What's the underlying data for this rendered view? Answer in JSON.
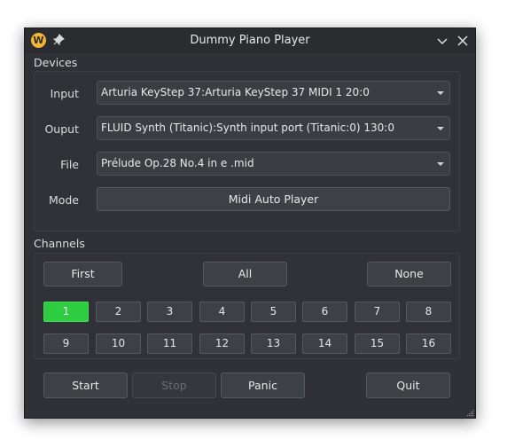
{
  "window": {
    "title": "Dummy Piano Player"
  },
  "icons": {
    "app": "app-logo-icon",
    "pin": "pin-icon",
    "collapse": "chevron-down-icon",
    "close": "close-icon"
  },
  "devices": {
    "group_label": "Devices",
    "input": {
      "label": "Input",
      "value": "Arturia KeyStep 37:Arturia KeyStep 37 MIDI 1 20:0"
    },
    "output": {
      "label": "Ouput",
      "value": "FLUID Synth (Titanic):Synth input port (Titanic:0) 130:0"
    },
    "file": {
      "label": "File",
      "value": "Prélude Op.28 No.4 in e .mid"
    },
    "mode": {
      "label": "Mode",
      "value": "Midi Auto Player"
    }
  },
  "channels": {
    "group_label": "Channels",
    "first_label": "First",
    "all_label": "All",
    "none_label": "None",
    "buttons": [
      "1",
      "2",
      "3",
      "4",
      "5",
      "6",
      "7",
      "8",
      "9",
      "10",
      "11",
      "12",
      "13",
      "14",
      "15",
      "16"
    ],
    "active": [
      "1"
    ]
  },
  "controls": {
    "start": "Start",
    "stop": "Stop",
    "panic": "Panic",
    "quit": "Quit"
  },
  "colors": {
    "accent": "#2ecc40",
    "window_bg": "#2f3136",
    "app_icon": "#f2b632"
  }
}
